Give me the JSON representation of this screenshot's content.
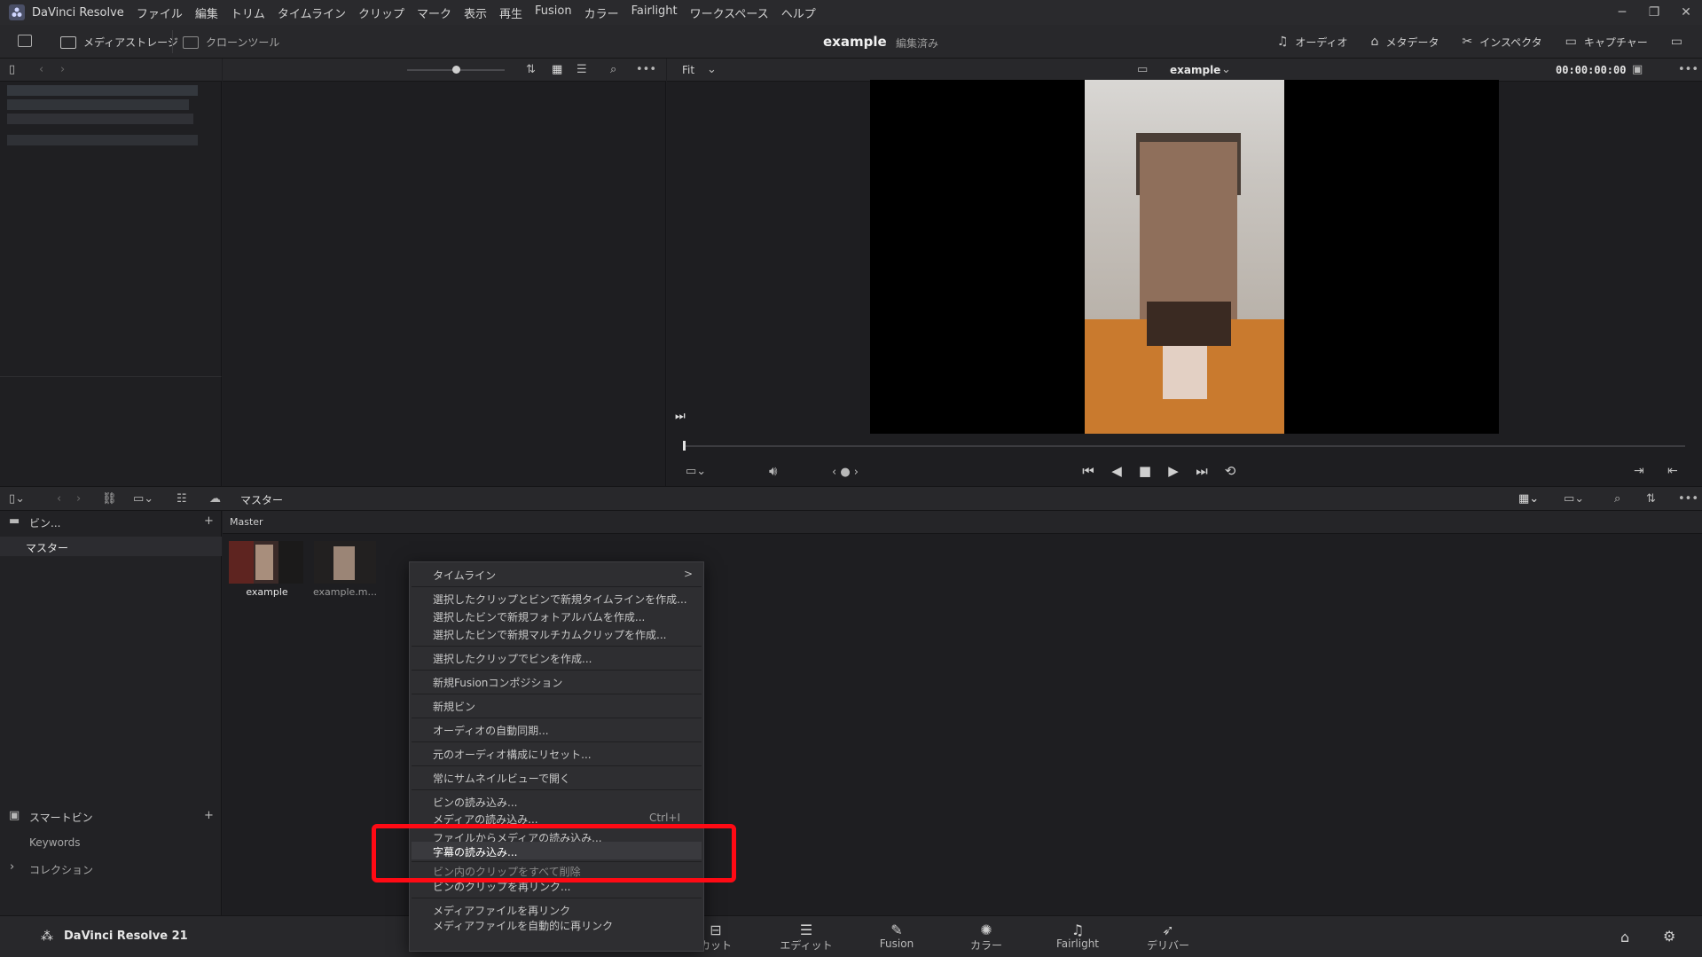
{
  "app": {
    "title": "DaVinci Resolve",
    "menu": [
      "ファイル",
      "編集",
      "トリム",
      "タイムライン",
      "クリップ",
      "マーク",
      "表示",
      "再生",
      "Fusion",
      "カラー",
      "Fairlight",
      "ワークスペース",
      "ヘルプ"
    ],
    "window_controls": [
      "─",
      "❐",
      "✕"
    ]
  },
  "toolbar": {
    "media_storage": "メディアストレージ",
    "clone_tool": "クローンツール",
    "project_title": "example",
    "project_status": "編集済み",
    "audio": "オーディオ",
    "metadata": "メタデータ",
    "inspector": "インスペクタ",
    "capture": "キャプチャー"
  },
  "viewer": {
    "zoom": "Fit",
    "clip_name": "example",
    "timecode": "00:00:00:00"
  },
  "media_pool": {
    "bin_header": "ビン...",
    "current_bin": "マスター",
    "bins": [
      "マスター"
    ],
    "pool_header": "Master",
    "smart_bins_header": "スマートビン",
    "smart_bins": [
      "Keywords"
    ],
    "collections": "コレクション",
    "clips": [
      {
        "name": "example"
      },
      {
        "name": "example.m..."
      }
    ]
  },
  "context_menu": {
    "items": [
      {
        "label": "タイムライン",
        "submenu": ">"
      },
      {
        "label": "選択したクリップとビンで新規タイムラインを作成..."
      },
      {
        "label": "選択したビンで新規フォトアルバムを作成..."
      },
      {
        "label": "選択したビンで新規マルチカムクリップを作成..."
      },
      {
        "label": "選択したクリップでビンを作成..."
      },
      {
        "label": "新規Fusionコンポジション"
      },
      {
        "label": "新規ビン"
      },
      {
        "label": "オーディオの自動同期..."
      },
      {
        "label": "元のオーディオ構成にリセット..."
      },
      {
        "label": "常にサムネイルビューで開く"
      },
      {
        "label": "ビンの読み込み..."
      },
      {
        "label": "メディアの読み込み...",
        "shortcut": "Ctrl+I"
      },
      {
        "label": "ファイルからメディアの読み込み..."
      },
      {
        "label": "字幕の読み込み..."
      },
      {
        "label": "ビン内のクリップをすべて削除"
      },
      {
        "label": "ビンのクリップを再リンク..."
      },
      {
        "label": "メディアファイルを再リンク"
      },
      {
        "label": "メディアファイルを自動的に再リンク"
      }
    ]
  },
  "pages": {
    "brand": "DaVinci Resolve 21",
    "tabs": [
      "カット",
      "エディット",
      "Fusion",
      "カラー",
      "Fairlight",
      "デリバー"
    ]
  },
  "colors": {
    "highlight_box": "#ff0a14",
    "panel_bg": "#1e1e21"
  }
}
